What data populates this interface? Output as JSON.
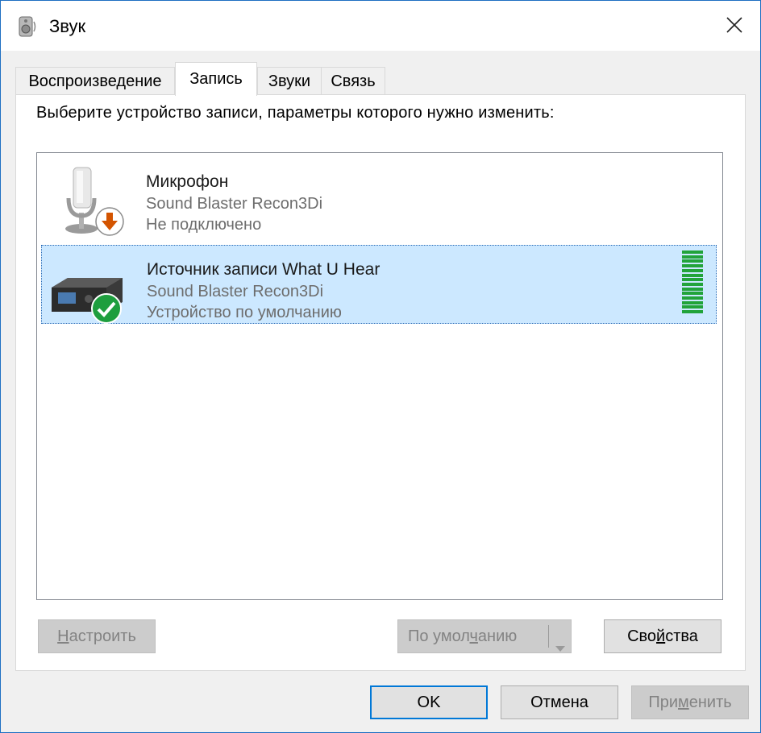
{
  "window": {
    "title": "Звук",
    "app_icon": "speaker-icon",
    "close_icon": "close-icon"
  },
  "tabs": [
    {
      "label": "Воспроизведение",
      "active": false
    },
    {
      "label": "Запись",
      "active": true
    },
    {
      "label": "Звуки",
      "active": false
    },
    {
      "label": "Связь",
      "active": false
    }
  ],
  "instruction": "Выберите устройство записи, параметры которого нужно изменить:",
  "devices": [
    {
      "name": "Микрофон",
      "driver": "Sound Blaster Recon3Di",
      "status": "Не подключено",
      "icon": "microphone-icon",
      "badge": "disconnected-arrow-icon",
      "selected": false
    },
    {
      "name": "Источник записи What U Hear",
      "driver": "Sound Blaster Recon3Di",
      "status": "Устройство по умолчанию",
      "icon": "audio-device-icon",
      "badge": "default-check-icon",
      "selected": true,
      "level_fraction": 1.0
    }
  ],
  "buttons": {
    "configure": {
      "pre": "",
      "key": "Н",
      "post": "астроить",
      "enabled": false
    },
    "set_default": {
      "pre": "По умол",
      "key": "ч",
      "post": "анию",
      "enabled": false
    },
    "properties": {
      "pre": "Сво",
      "key": "й",
      "post": "ства",
      "enabled": true
    },
    "ok": {
      "label": "OK"
    },
    "cancel": {
      "label": "Отмена"
    },
    "apply": {
      "pre": "При",
      "key": "м",
      "post": "енить",
      "enabled": false
    }
  },
  "colors": {
    "accent": "#0078d7",
    "selection": "#cce8ff",
    "level_green": "#21a33a"
  }
}
